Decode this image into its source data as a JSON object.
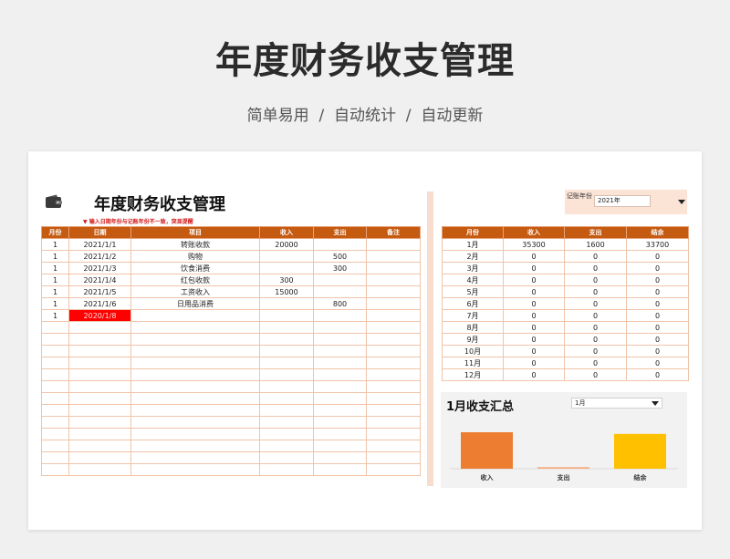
{
  "page": {
    "title": "年度财务收支管理",
    "subtitle": "简单易用  /  自动统计  /  自动更新"
  },
  "sheet": {
    "title": "年度财务收支管理",
    "warning": "▼ 输入日期年份与记账年份不一致，突显提醒",
    "icon": "wallet-icon",
    "year_label": "记账年份",
    "year_value": "2021年"
  },
  "ledger": {
    "headers": [
      "月份",
      "日期",
      "项目",
      "收入",
      "支出",
      "备注"
    ],
    "rows": [
      [
        "1",
        "2021/1/1",
        "转账收款",
        "20000",
        "",
        ""
      ],
      [
        "1",
        "2021/1/2",
        "购物",
        "",
        "500",
        ""
      ],
      [
        "1",
        "2021/1/3",
        "饮食消费",
        "",
        "300",
        ""
      ],
      [
        "1",
        "2021/1/4",
        "红包收款",
        "300",
        "",
        ""
      ],
      [
        "1",
        "2021/1/5",
        "工资收入",
        "15000",
        "",
        ""
      ],
      [
        "1",
        "2021/1/6",
        "日用品消费",
        "",
        "800",
        ""
      ],
      [
        "1",
        "2020/1/8",
        "",
        "",
        "",
        ""
      ]
    ],
    "highlight_color": "#ff0000"
  },
  "summary": {
    "headers": [
      "月份",
      "收入",
      "支出",
      "结余"
    ],
    "rows": [
      [
        "1月",
        "35300",
        "1600",
        "33700"
      ],
      [
        "2月",
        "0",
        "0",
        "0"
      ],
      [
        "3月",
        "0",
        "0",
        "0"
      ],
      [
        "4月",
        "0",
        "0",
        "0"
      ],
      [
        "5月",
        "0",
        "0",
        "0"
      ],
      [
        "6月",
        "0",
        "0",
        "0"
      ],
      [
        "7月",
        "0",
        "0",
        "0"
      ],
      [
        "8月",
        "0",
        "0",
        "0"
      ],
      [
        "9月",
        "0",
        "0",
        "0"
      ],
      [
        "10月",
        "0",
        "0",
        "0"
      ],
      [
        "11月",
        "0",
        "0",
        "0"
      ],
      [
        "12月",
        "0",
        "0",
        "0"
      ]
    ]
  },
  "chart_panel": {
    "title": "1月收支汇总",
    "month_value": "1月"
  },
  "chart_data": {
    "type": "bar",
    "categories": [
      "收入",
      "支出",
      "结余"
    ],
    "values": [
      35300,
      1600,
      33700
    ],
    "colors": [
      "#ed7d31",
      "#f4b183",
      "#ffc000"
    ],
    "ylim": [
      0,
      35300
    ],
    "grid": false
  },
  "colors": {
    "header": "#c55a11",
    "border": "#f0c4a8",
    "accent_bg": "#fbe3d6"
  }
}
